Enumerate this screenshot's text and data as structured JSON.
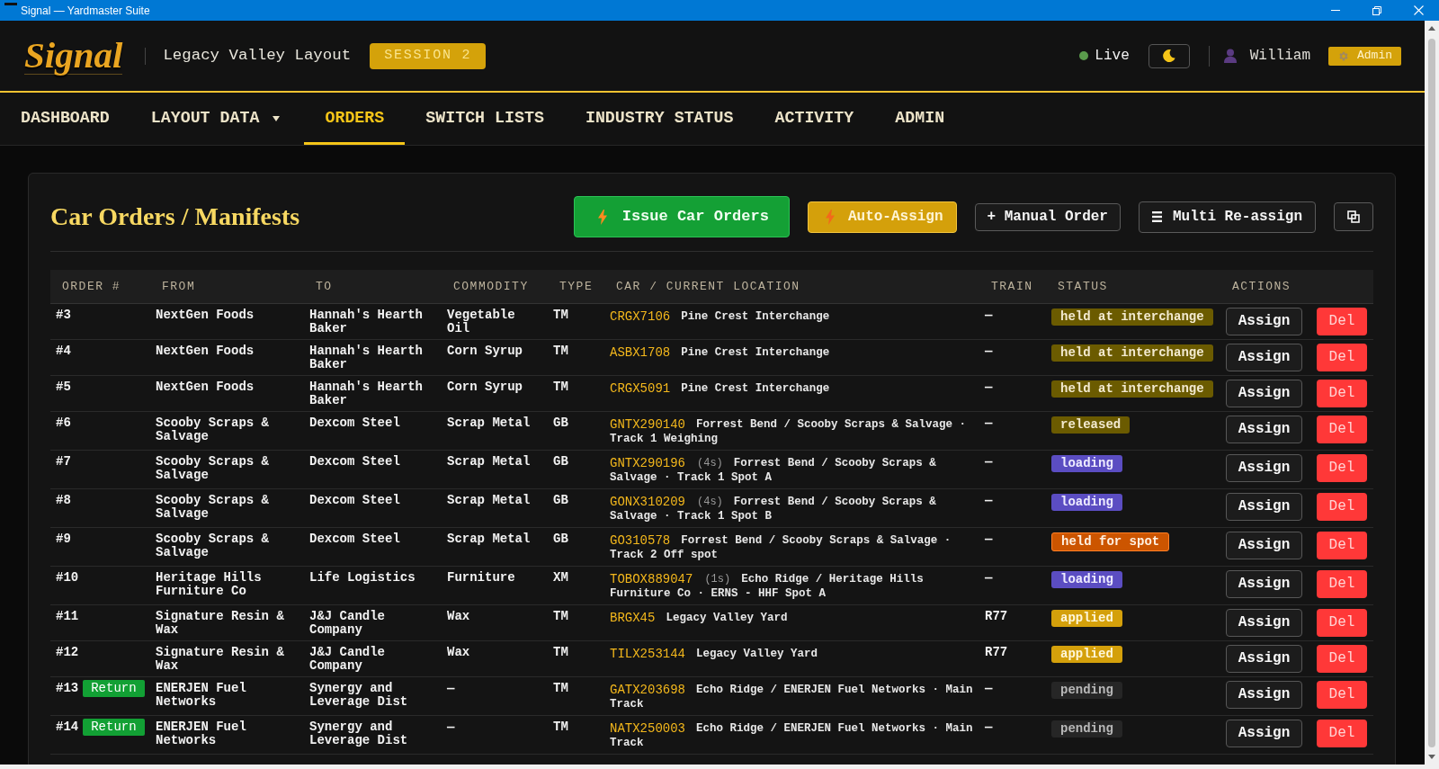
{
  "window": {
    "title": "Signal — Yardmaster Suite"
  },
  "header": {
    "logo": "Signal",
    "layout_name": "Legacy Valley Layout",
    "session_badge": "SESSION 2",
    "connection": {
      "label": "Live",
      "online": true
    },
    "user": {
      "name": "William",
      "role": "Admin"
    }
  },
  "nav": [
    {
      "label": "DASHBOARD",
      "selected": false,
      "dropdown": false
    },
    {
      "label": "LAYOUT DATA",
      "selected": false,
      "dropdown": true
    },
    {
      "label": "ORDERS",
      "selected": true,
      "dropdown": false
    },
    {
      "label": "SWITCH LISTS",
      "selected": false,
      "dropdown": false
    },
    {
      "label": "INDUSTRY STATUS",
      "selected": false,
      "dropdown": false
    },
    {
      "label": "ACTIVITY",
      "selected": false,
      "dropdown": false
    },
    {
      "label": "ADMIN",
      "selected": false,
      "dropdown": false
    }
  ],
  "panel": {
    "title": "Car Orders / Manifests",
    "toolbar": [
      {
        "kind": "issue",
        "label": "Issue Car Orders"
      },
      {
        "kind": "auto",
        "label": "Auto-Assign"
      },
      {
        "kind": "plain",
        "label": "+ Manual Order"
      },
      {
        "kind": "list",
        "label": "Multi Re-assign"
      },
      {
        "kind": "icon"
      }
    ],
    "table": {
      "columns": [
        "ORDER #",
        "FROM",
        "TO",
        "COMMODITY",
        "TYPE",
        "CAR / CURRENT LOCATION",
        "TRAIN",
        "STATUS",
        "ACTIONS"
      ],
      "rows": [
        {
          "order": "#3",
          "from": "NextGen Foods",
          "to": "Hannah's Hearth Baker",
          "commodity": "Vegetable Oil",
          "type": "TM",
          "car": "CRGX7106",
          "location": "Pine Crest Interchange",
          "train": "—",
          "status": {
            "label": "held at interchange",
            "kind": "hold"
          },
          "actions": [
            "Assign",
            "Del"
          ]
        },
        {
          "order": "#4",
          "from": "NextGen Foods",
          "to": "Hannah's Hearth Baker",
          "commodity": "Corn Syrup",
          "type": "TM",
          "car": "ASBX1708",
          "location": "Pine Crest Interchange",
          "train": "—",
          "status": {
            "label": "held at interchange",
            "kind": "hold"
          },
          "actions": [
            "Assign",
            "Del"
          ]
        },
        {
          "order": "#5",
          "from": "NextGen Foods",
          "to": "Hannah's Hearth Baker",
          "commodity": "Corn Syrup",
          "type": "TM",
          "car": "CRGX5091",
          "location": "Pine Crest Interchange",
          "train": "—",
          "status": {
            "label": "held at interchange",
            "kind": "hold"
          },
          "actions": [
            "Assign",
            "Del"
          ]
        },
        {
          "order": "#6",
          "from": "Scooby Scraps & Salvage",
          "to": "Dexcom Steel",
          "commodity": "Scrap Metal",
          "type": "GB",
          "car": "GNTX290140",
          "location": "Forrest Bend / Scooby Scraps & Salvage · Track 1 Weighing",
          "train": "—",
          "status": {
            "label": "released",
            "kind": "hold"
          },
          "actions": [
            "Assign",
            "Del"
          ]
        },
        {
          "order": "#7",
          "from": "Scooby Scraps & Salvage",
          "to": "Dexcom Steel",
          "commodity": "Scrap Metal",
          "type": "GB",
          "car": "GNTX290196",
          "dwell": "(4s)",
          "location": "Forrest Bend / Scooby Scraps & Salvage · Track 1 Spot A",
          "train": "—",
          "status": {
            "label": "loading",
            "kind": "loading"
          },
          "actions": [
            "Assign",
            "Del"
          ]
        },
        {
          "order": "#8",
          "from": "Scooby Scraps & Salvage",
          "to": "Dexcom Steel",
          "commodity": "Scrap Metal",
          "type": "GB",
          "car": "GONX310209",
          "dwell": "(4s)",
          "location": "Forrest Bend / Scooby Scraps & Salvage · Track 1 Spot B",
          "train": "—",
          "status": {
            "label": "loading",
            "kind": "loading"
          },
          "actions": [
            "Assign",
            "Del"
          ]
        },
        {
          "order": "#9",
          "from": "Scooby Scraps & Salvage",
          "to": "Dexcom Steel",
          "commodity": "Scrap Metal",
          "type": "GB",
          "car": "GO310578",
          "location": "Forrest Bend / Scooby Scraps & Salvage · Track 2 Off spot",
          "train": "—",
          "status": {
            "label": "held for spot",
            "kind": "spot"
          },
          "actions": [
            "Assign",
            "Del"
          ]
        },
        {
          "order": "#10",
          "from": "Heritage Hills Furniture Co",
          "to": "Life Logistics",
          "commodity": "Furniture",
          "type": "XM",
          "car": "TOBOX889047",
          "dwell": "(1s)",
          "location": "Echo Ridge / Heritage Hills Furniture Co · ERNS - HHF Spot A",
          "train": "—",
          "status": {
            "label": "loading",
            "kind": "loading"
          },
          "actions": [
            "Assign",
            "Del"
          ]
        },
        {
          "order": "#11",
          "from": "Signature Resin & Wax",
          "to": "J&J Candle Company",
          "commodity": "Wax",
          "type": "TM",
          "car": "BRGX45",
          "location": "Legacy Valley Yard",
          "train": "R77",
          "status": {
            "label": "applied",
            "kind": "applied"
          },
          "actions": [
            "Assign",
            "Del"
          ]
        },
        {
          "order": "#12",
          "from": "Signature Resin & Wax",
          "to": "J&J Candle Company",
          "commodity": "Wax",
          "type": "TM",
          "car": "TILX253144",
          "location": "Legacy Valley Yard",
          "train": "R77",
          "status": {
            "label": "applied",
            "kind": "applied"
          },
          "actions": [
            "Assign",
            "Del"
          ]
        },
        {
          "order": "#13",
          "tag": "Return",
          "from": "ENERJEN Fuel Networks",
          "to": "Synergy and Leverage Dist",
          "commodity": "—",
          "type": "TM",
          "car": "GATX203698",
          "location": "Echo Ridge / ENERJEN Fuel Networks · Main Track",
          "train": "—",
          "status": {
            "label": "pending",
            "kind": "pending"
          },
          "actions": [
            "Assign",
            "Del"
          ]
        },
        {
          "order": "#14",
          "tag": "Return",
          "from": "ENERJEN Fuel Networks",
          "to": "Synergy and Leverage Dist",
          "commodity": "—",
          "type": "TM",
          "car": "NATX250003",
          "location": "Echo Ridge / ENERJEN Fuel Networks · Main Track",
          "train": "—",
          "status": {
            "label": "pending",
            "kind": "pending"
          },
          "actions": [
            "Assign",
            "Del"
          ]
        }
      ]
    }
  }
}
